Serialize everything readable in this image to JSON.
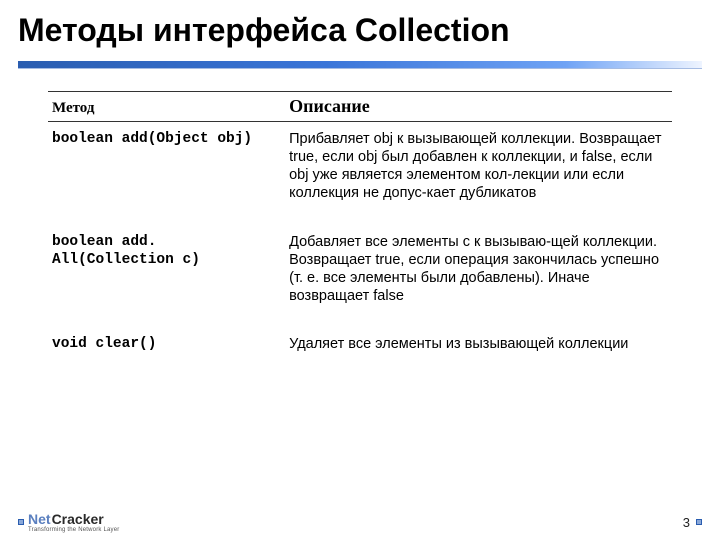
{
  "title": "Методы интерфейса Collection",
  "table": {
    "headers": {
      "method": "Метод",
      "description": "Описание"
    },
    "rows": [
      {
        "method": "boolean add(Object obj)",
        "description": "Прибавляет obj к вызывающей коллекции. Возвращает true, если obj был добавлен к коллекции, и false, если obj  уже является элементом кол-лекции или если коллекция не допус-кает дубликатов"
      },
      {
        "method": "boolean add. All(Collection c)",
        "description": "Добавляет все элементы с к вызываю-щей коллекции. Возвращает true, если операция закончилась успешно (т. е. все элементы были добавлены). Иначе возвращает false"
      },
      {
        "method": "void clear()",
        "description": "Удаляет все элементы из вызывающей коллекции"
      }
    ]
  },
  "footer": {
    "logo_left": "Net",
    "logo_right": "Cracker",
    "logo_tagline": "Transforming the Network Layer",
    "page_number": "3"
  }
}
